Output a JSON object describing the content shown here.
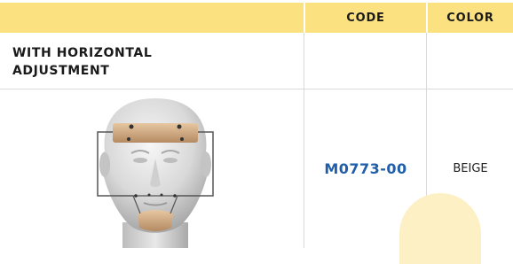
{
  "header": {
    "code_label": "CODE",
    "color_label": "COLOR"
  },
  "rows": [
    {
      "title_line1": "WITH HORIZONTAL",
      "title_line2": "ADJUSTMENT"
    },
    {
      "code": "M0773-00",
      "color": "BEIGE",
      "image_description": "mannequin-head-with-facemask"
    }
  ],
  "colors": {
    "header_bg": "#fce181",
    "code_text": "#1f5ea9",
    "grid_line": "#d9d9d9"
  }
}
